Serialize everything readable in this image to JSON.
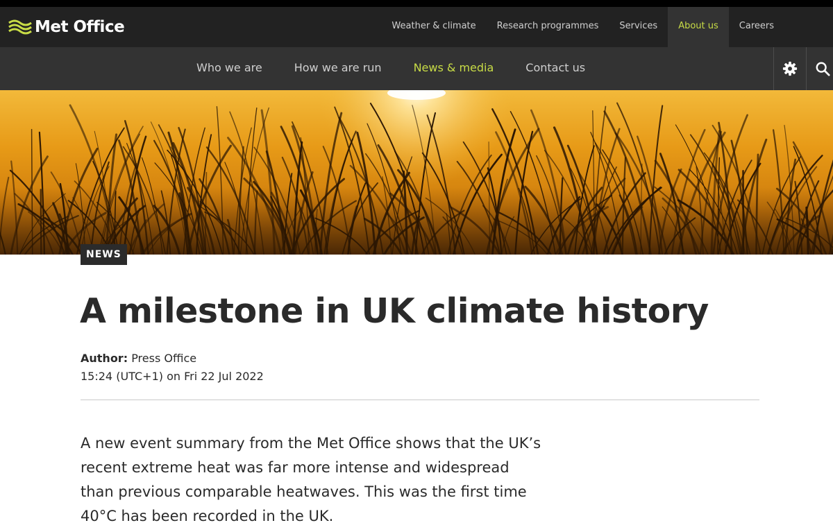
{
  "brand": {
    "name": "Met Office",
    "accent": "#c8dc46",
    "header_dark": "#222222",
    "header_sub": "#333333"
  },
  "primary_nav": [
    {
      "label": "Weather & climate",
      "active": false
    },
    {
      "label": "Research programmes",
      "active": false
    },
    {
      "label": "Services",
      "active": false
    },
    {
      "label": "About us",
      "active": true
    },
    {
      "label": "Careers",
      "active": false
    }
  ],
  "secondary_nav": [
    {
      "label": "Who we are",
      "active": false
    },
    {
      "label": "How we are run",
      "active": false
    },
    {
      "label": "News & media",
      "active": true
    },
    {
      "label": "Contact us",
      "active": false
    }
  ],
  "tools": {
    "settings_icon": "gear-icon",
    "search_icon": "search-icon"
  },
  "hero": {
    "description_icon": "sunset-grass-image"
  },
  "article": {
    "tag": "NEWS",
    "title": "A milestone in UK climate history",
    "author_label": "Author:",
    "author": "Press Office",
    "published": "15:24 (UTC+1) on Fri 22 Jul 2022",
    "lead": "A new event summary from the Met Office shows that the UK’s recent extreme heat was far more intense and widespread than previous comparable heatwaves. This was the first time 40°C has been recorded in the UK."
  }
}
